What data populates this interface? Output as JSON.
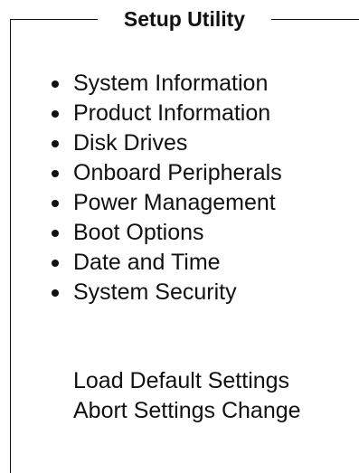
{
  "title": "Setup Utility",
  "menu": {
    "items": [
      {
        "label": "System Information",
        "icon": "bullet-icon"
      },
      {
        "label": "Product Information",
        "icon": "bullet-icon"
      },
      {
        "label": "Disk Drives",
        "icon": "bullet-icon"
      },
      {
        "label": "Onboard Peripherals",
        "icon": "bullet-icon"
      },
      {
        "label": "Power Management",
        "icon": "bullet-icon"
      },
      {
        "label": "Boot Options",
        "icon": "bullet-icon"
      },
      {
        "label": "Date and Time",
        "icon": "bullet-icon"
      },
      {
        "label": "System Security",
        "icon": "bullet-icon"
      }
    ]
  },
  "actions": {
    "load_default": "Load Default Settings",
    "abort_changes": "Abort Settings Change"
  },
  "colors": {
    "text": "#111111",
    "background": "#ffffff",
    "frame": "#111111"
  }
}
